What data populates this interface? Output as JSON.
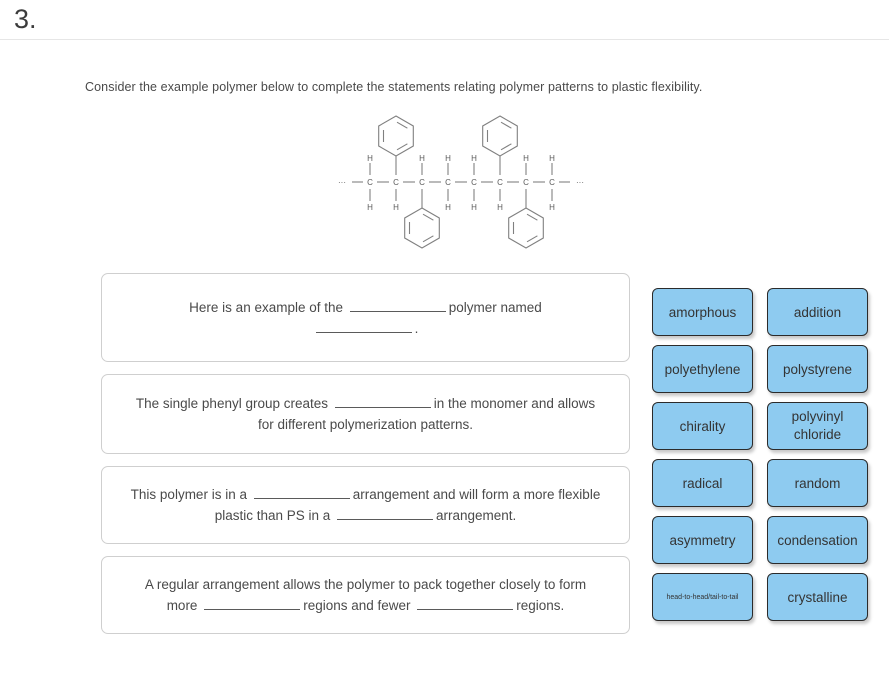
{
  "header": {
    "question_number": "3."
  },
  "prompt": {
    "text": "Consider the example polymer below to complete the statements relating polymer patterns to plastic flexibility."
  },
  "structure": {
    "name": "polystyrene-chain-diagram",
    "backbone_label": "C",
    "hydrogen_label": "H",
    "ellipsis": "···",
    "backbone_carbons": 8,
    "phenyl_rings_up_at": [
      2,
      6
    ],
    "phenyl_rings_down_at": [
      3,
      7
    ],
    "line_color": "#808080"
  },
  "statements": [
    {
      "id": "statement-0",
      "segments": [
        {
          "type": "text",
          "value": "Here is an example of the"
        },
        {
          "type": "blank"
        },
        {
          "type": "text",
          "value": "polymer named"
        },
        {
          "type": "break"
        },
        {
          "type": "blank"
        },
        {
          "type": "text",
          "value": "."
        }
      ]
    },
    {
      "id": "statement-1",
      "segments": [
        {
          "type": "text",
          "value": "The single phenyl group creates"
        },
        {
          "type": "blank"
        },
        {
          "type": "text",
          "value": "in the monomer and allows for different polymerization patterns."
        }
      ]
    },
    {
      "id": "statement-2",
      "segments": [
        {
          "type": "text",
          "value": "This polymer is in a"
        },
        {
          "type": "blank"
        },
        {
          "type": "text",
          "value": "arrangement and will form a more flexible plastic than PS in a"
        },
        {
          "type": "blank"
        },
        {
          "type": "text",
          "value": "arrangement."
        }
      ]
    },
    {
      "id": "statement-3",
      "segments": [
        {
          "type": "text",
          "value": "A regular arrangement allows the polymer to pack together closely to form more"
        },
        {
          "type": "blank"
        },
        {
          "type": "text",
          "value": "regions and fewer"
        },
        {
          "type": "blank"
        },
        {
          "type": "text",
          "value": "regions."
        }
      ]
    }
  ],
  "answer_tiles": [
    {
      "label": "amorphous",
      "size": "normal"
    },
    {
      "label": "addition",
      "size": "normal"
    },
    {
      "label": "polyethylene",
      "size": "normal"
    },
    {
      "label": "polystyrene",
      "size": "normal"
    },
    {
      "label": "chirality",
      "size": "normal"
    },
    {
      "label": "polyvinyl chloride",
      "size": "wrap"
    },
    {
      "label": "radical",
      "size": "normal"
    },
    {
      "label": "random",
      "size": "normal"
    },
    {
      "label": "asymmetry",
      "size": "normal"
    },
    {
      "label": "condensation",
      "size": "normal"
    },
    {
      "label": "head-to-head/tail-to-tail",
      "size": "tiny"
    },
    {
      "label": "crystalline",
      "size": "normal"
    }
  ],
  "colors": {
    "tile_fill": "#8ecbf0",
    "tile_border": "#2b2b2b",
    "box_border": "#cfcfcf",
    "text": "#4a4a4a",
    "structure_line": "#808080"
  }
}
